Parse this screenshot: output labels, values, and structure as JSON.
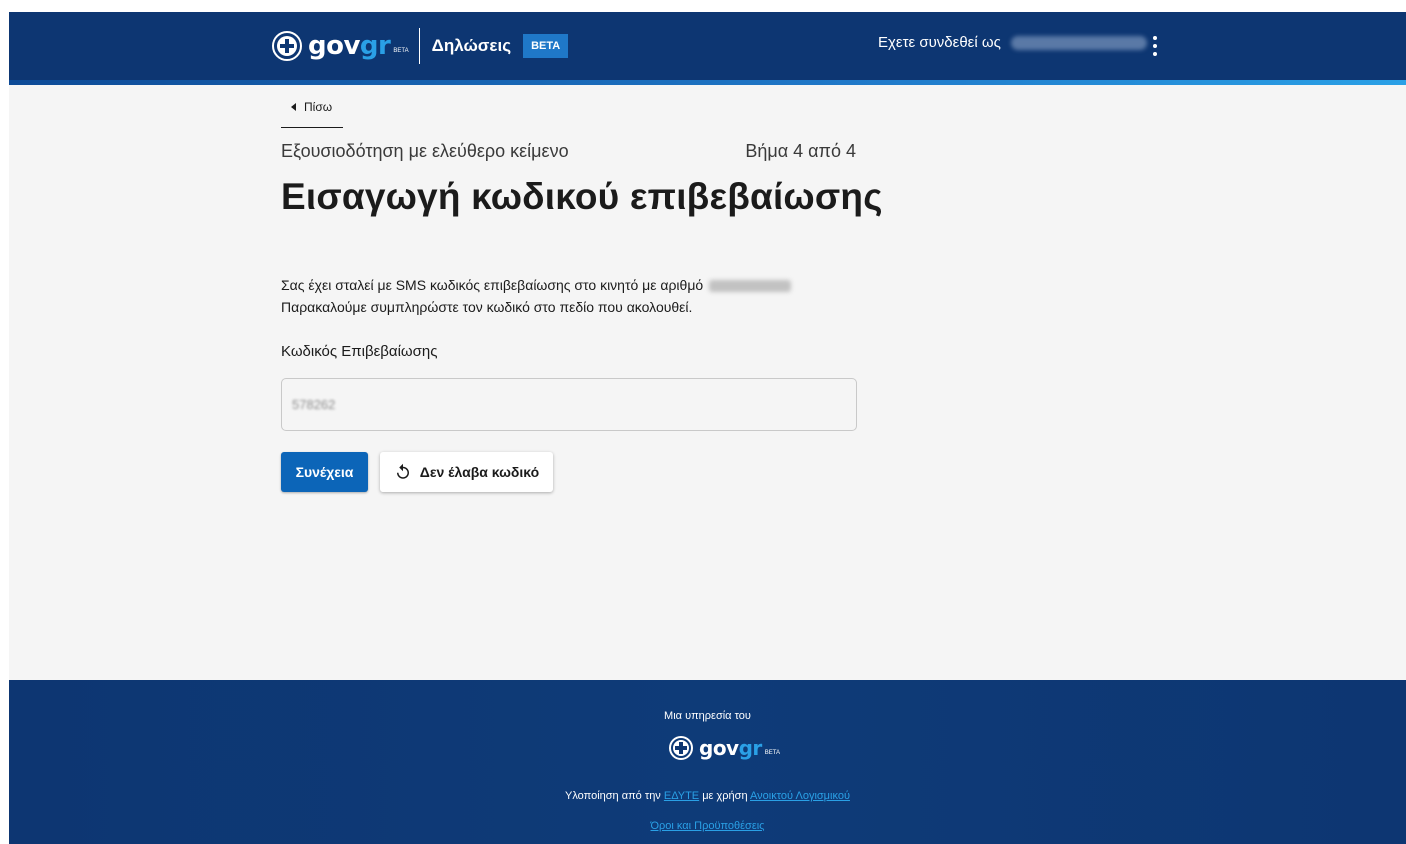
{
  "header": {
    "logo_gov": "gov",
    "logo_gr": "gr",
    "logo_beta": "BETA",
    "app_name": "Δηλώσεις",
    "beta_badge": "BETA",
    "logged_in_text": "Εχετε συνδεθεί ως"
  },
  "back": {
    "label": "Πίσω"
  },
  "form": {
    "subtitle": "Εξουσιοδότηση με ελεύθερο κείμενο",
    "step": "Βήμα 4 από 4",
    "title": "Εισαγωγή κωδικού επιβεβαίωσης",
    "message_line1": "Σας έχει σταλεί με SMS κωδικός επιβεβαίωσης στο κινητό με αριθμό",
    "message_line2": "Παρακαλούμε συμπληρώστε τον κωδικό στο πεδίο που ακολουθεί.",
    "code_label": "Κωδικός Επιβεβαίωσης",
    "code_value": "578262",
    "continue_button": "Συνέχεια",
    "resend_button": "Δεν έλαβα κωδικό"
  },
  "footer": {
    "service_of": "Μια υπηρεσία του",
    "impl_prefix": "Υλοποίηση από την",
    "impl_org": "ΕΔΥΤΕ",
    "impl_middle": "με χρήση",
    "impl_software": "Ανοικτού Λογισμικού",
    "terms": "Όροι και Προϋποθέσεις"
  },
  "colors": {
    "header_bg": "#0d3672",
    "accent": "#2aa0e6",
    "primary_button": "#0c65b8"
  }
}
